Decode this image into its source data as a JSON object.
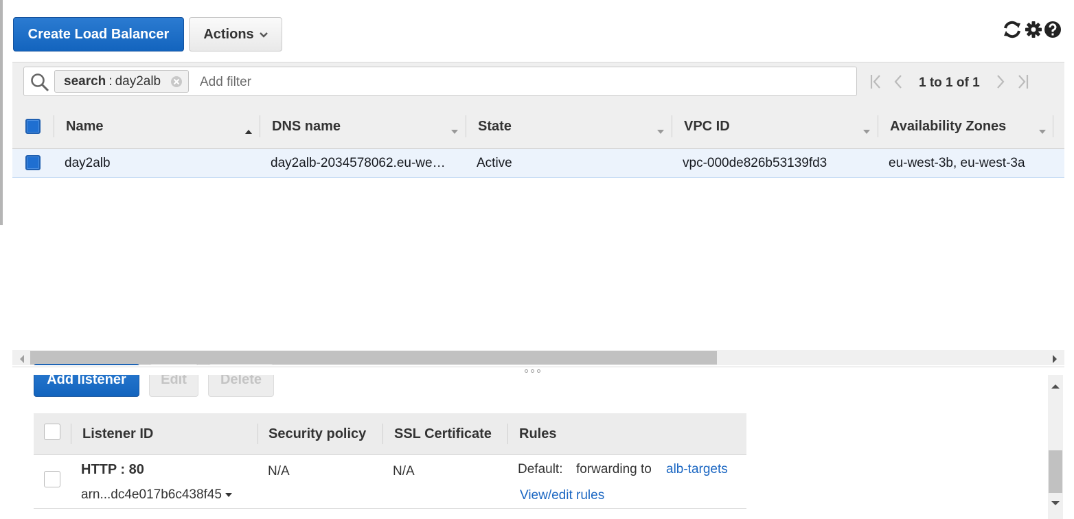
{
  "toolbar": {
    "create_label": "Create Load Balancer",
    "actions_label": "Actions",
    "icons": [
      "refresh-icon",
      "gear-icon",
      "help-icon"
    ]
  },
  "filter": {
    "token_key": "search",
    "token_sep": ":",
    "token_value": "day2alb",
    "placeholder": "Add filter"
  },
  "pagination": {
    "text": "1 to 1 of 1"
  },
  "grid": {
    "columns": [
      {
        "label": "Name",
        "sort": "ascending"
      },
      {
        "label": "DNS name",
        "sort": "none"
      },
      {
        "label": "State",
        "sort": "none"
      },
      {
        "label": "VPC ID",
        "sort": "none"
      },
      {
        "label": "Availability Zones",
        "sort": "none"
      }
    ],
    "rows": [
      {
        "selected": true,
        "name": "day2alb",
        "dns": "day2alb-2034578062.eu-we…",
        "state": "Active",
        "vpc": "vpc-000de826b53139fd3",
        "zones": "eu-west-3b, eu-west-3a"
      }
    ]
  },
  "listeners": {
    "buttons": {
      "add": "Add listener",
      "edit": "Edit",
      "delete": "Delete"
    },
    "columns": [
      "Listener ID",
      "Security policy",
      "SSL Certificate",
      "Rules"
    ],
    "rows": [
      {
        "protocol": "HTTP : 80",
        "arn": "arn...dc4e017b6c438f45",
        "security_policy": "N/A",
        "ssl_certificate": "N/A",
        "rules_prefix": "Default:",
        "rules_text": "forwarding to",
        "rules_target": "alb-targets",
        "view_rules": "View/edit rules"
      }
    ]
  },
  "colors": {
    "primary": "#1f6fd1",
    "link": "#1a66c2",
    "selected_row": "#ecf3fc"
  }
}
